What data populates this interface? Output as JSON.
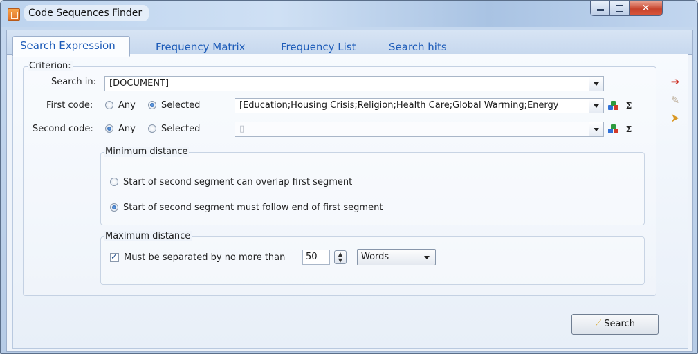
{
  "window": {
    "title": "Code Sequences Finder",
    "close_glyph": "✕"
  },
  "tabs": [
    {
      "label": "Search Expression",
      "active": true
    },
    {
      "label": "Frequency Matrix",
      "active": false
    },
    {
      "label": "Frequency List",
      "active": false
    },
    {
      "label": "Search hits",
      "active": false
    }
  ],
  "criterion": {
    "legend": "Criterion:",
    "search_in": {
      "label": "Search in:",
      "value": "[DOCUMENT]"
    },
    "first_code": {
      "label": "First code:",
      "option_any": "Any",
      "option_selected": "Selected",
      "selected": "Selected",
      "value": "[Education;Housing Crisis;Religion;Health Care;Global Warming;Energy"
    },
    "second_code": {
      "label": "Second code:",
      "option_any": "Any",
      "option_selected": "Selected",
      "selected": "Any",
      "value": "▯"
    },
    "minimum_distance": {
      "legend": "Minimum distance",
      "option_overlap": "Start of second segment can overlap first segment",
      "option_follow": "Start of second segment must follow end of first segment",
      "selected": "follow"
    },
    "maximum_distance": {
      "legend": "Maximum distance",
      "checkbox_label": "Must be separated by no more than",
      "checked": true,
      "value": "50",
      "unit": "Words"
    }
  },
  "actions": {
    "search_button": "Search"
  },
  "icons": {
    "exit": "exit-icon",
    "open": "open-folder-icon",
    "save": "save-icon",
    "code_tree": "code-tree-icon",
    "sigma": "Σ"
  },
  "colors": {
    "tab_text": "#1c5bb8",
    "close_red": "#c6432c",
    "accent_blue": "#1c4f98"
  }
}
